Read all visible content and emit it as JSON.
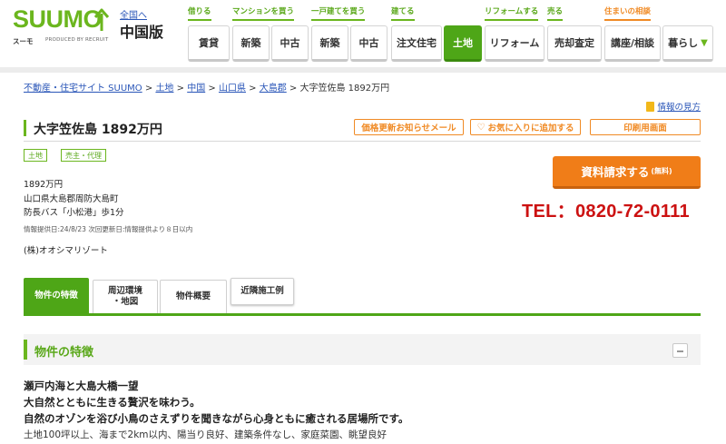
{
  "header": {
    "logo_text": "SUUMO",
    "logo_kana": "スーモ",
    "logo_recruit": "PRODUCED BY RECRUIT",
    "region_link": "全国へ",
    "region_name": "中国版",
    "categories": {
      "rent": "借りる",
      "mansion": "マンションを買う",
      "house": "一戸建てを買う",
      "build": "建てる",
      "reform": "リフォームする",
      "sell": "売る",
      "consult": "住まいの相談"
    },
    "nav": {
      "rent": "賃貸",
      "mansion_new": "新築",
      "mansion_used": "中古",
      "house_new": "新築",
      "house_used": "中古",
      "custom": "注文住宅",
      "land": "土地",
      "reform": "リフォーム",
      "appraisal": "売却査定",
      "course": "講座/相談",
      "living": "暮らし"
    }
  },
  "breadcrumb": {
    "items": [
      "不動産・住宅サイト SUUMO",
      "土地",
      "中国",
      "山口県",
      "大島郡"
    ],
    "sep": ">",
    "current": "大字笠佐島 1892万円"
  },
  "info_help": "情報の見方",
  "property": {
    "title": "大字笠佐島 1892万円",
    "tags": [
      "土地",
      "売主・代理"
    ],
    "price": "1892万円",
    "address": "山口県大島郡周防大島町",
    "access": "防長バス「小松港」歩1分",
    "update_info": "情報提供日:24/8/23  次回更新日:情報提供より８日以内",
    "company": "(株)オオシマリゾート"
  },
  "actions": {
    "price_alert": "価格更新お知らせメール",
    "favorite": "お気に入りに追加する",
    "print": "印刷用画面"
  },
  "cta": {
    "label": "資料請求する",
    "free": "(無料)"
  },
  "tel": "TEL：0820-72-0111",
  "tabs": {
    "features": "物件の特徴",
    "environment_1": "周辺環境",
    "environment_2": "・地図",
    "overview": "物件概要",
    "nearby": "近隣施工例"
  },
  "section": {
    "title": "物件の特徴",
    "lead_1": "瀬戸内海と大島大橋一望",
    "lead_2": "大自然とともに生きる贅沢を味わう。",
    "lead_3": "自然のオゾンを浴び小鳥のさえずりを聞きながら心身ともに癒される居場所です。",
    "tags_line": "土地100坪以上、海まで2km以内、陽当り良好、建築条件なし、家庭菜園、眺望良好"
  },
  "colors": {
    "brand_green": "#6bb61e",
    "active_green": "#4ea617",
    "accent_orange": "#f07d18",
    "tel_red": "#cc1111",
    "link_blue": "#2a56b8"
  }
}
